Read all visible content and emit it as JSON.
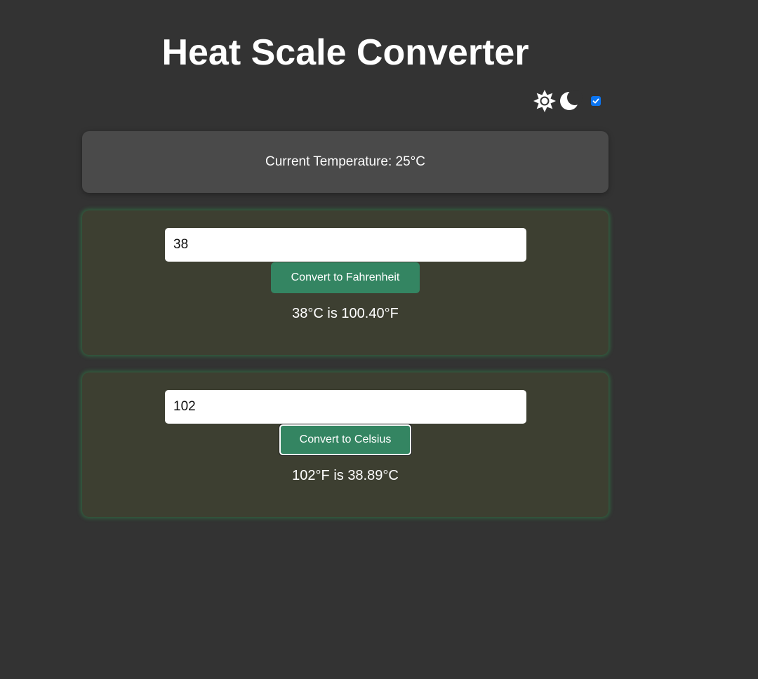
{
  "header": {
    "title": "Heat Scale Converter"
  },
  "theme_switch": {
    "light_icon": "sun-icon",
    "dark_icon": "moon-icon",
    "checked": true
  },
  "current_temperature": {
    "text": "Current Temperature: 25°C"
  },
  "celsius_to_fahrenheit": {
    "input_value": "38",
    "button_label": "Convert to Fahrenheit",
    "result": "38°C is 100.40°F"
  },
  "fahrenheit_to_celsius": {
    "input_value": "102",
    "button_label": "Convert to Celsius",
    "result": "102°F is 38.89°C"
  },
  "colors": {
    "background": "#333333",
    "card": "#4a4a4a",
    "converter_card": "#3d3f31",
    "button": "#348562",
    "glow": "#2ea050",
    "checkbox": "#0b74f0"
  }
}
